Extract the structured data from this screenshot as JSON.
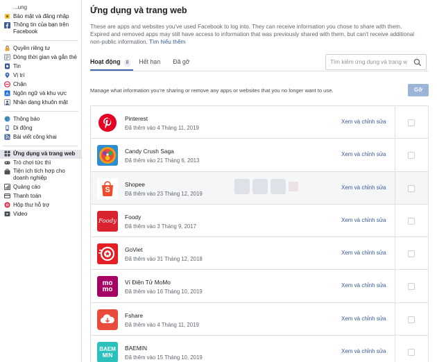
{
  "sidebar": {
    "items": [
      {
        "label": "...ung",
        "icon": "none",
        "partial": true
      },
      {
        "label": "Bảo mật và đăng nhập",
        "icon": "shield-key-icon"
      },
      {
        "label": "Thông tin của bạn trên Facebook",
        "icon": "facebook-icon"
      },
      {
        "label": "Quyền riêng tư",
        "icon": "lock-icon"
      },
      {
        "label": "Dòng thời gian và gắn thẻ",
        "icon": "timeline-icon"
      },
      {
        "label": "Tin",
        "icon": "story-icon"
      },
      {
        "label": "Vị trí",
        "icon": "location-icon"
      },
      {
        "label": "Chặn",
        "icon": "block-icon"
      },
      {
        "label": "Ngôn ngữ và khu vực",
        "icon": "language-icon"
      },
      {
        "label": "Nhận dạng khuôn mặt",
        "icon": "face-recognition-icon"
      },
      {
        "label": "Thông báo",
        "icon": "globe-icon"
      },
      {
        "label": "Di động",
        "icon": "mobile-icon"
      },
      {
        "label": "Bài viết công khai",
        "icon": "rss-icon"
      },
      {
        "label": "Ứng dụng và trang web",
        "icon": "apps-icon"
      },
      {
        "label": "Trò chơi tức thì",
        "icon": "game-icon"
      },
      {
        "label": "Tiện ích tích hợp cho doanh nghiệp",
        "icon": "business-icon"
      },
      {
        "label": "Quảng cáo",
        "icon": "ads-icon"
      },
      {
        "label": "Thanh toán",
        "icon": "payment-icon"
      },
      {
        "label": "Hộp thư hỗ trợ",
        "icon": "support-inbox-icon"
      },
      {
        "label": "Video",
        "icon": "video-icon"
      }
    ]
  },
  "main": {
    "title": "Ứng dụng và trang web",
    "description": "These are apps and websites you've used Facebook to log into. They can receive information you chose to share with them. Expired and removed apps may still have access to information that was previously shared with them, but can't receive additional non-public information.",
    "learn_more": "Tìm hiểu thêm",
    "tabs": [
      {
        "label": "Hoạt động",
        "count": "8"
      },
      {
        "label": "Hết hạn"
      },
      {
        "label": "Đã gỡ"
      }
    ],
    "search_placeholder": "Tìm kiếm ứng dụng và trang w",
    "manage_text": "Manage what information you're sharing or remove any apps or websites that you no longer want to use.",
    "remove_button": "Gỡ",
    "view_edit_label": "Xem và chỉnh sửa",
    "apps": [
      {
        "name": "Pinterest",
        "date": "Đã thêm vào 4 Tháng 11, 2019",
        "color": "#e60023",
        "logo": "pinterest-logo"
      },
      {
        "name": "Candy Crush Saga",
        "date": "Đã thêm vào 21 Tháng 6, 2013",
        "color": "#2a8fd4",
        "logo": "candy-crush-logo"
      },
      {
        "name": "Shopee",
        "date": "Đã thêm vào 23 Tháng 12, 2019",
        "color": "#ee4d2d",
        "logo": "shopee-logo"
      },
      {
        "name": "Foody",
        "date": "Đã thêm vào 3 Tháng 9, 2017",
        "color": "#d9232e",
        "logo": "foody-logo"
      },
      {
        "name": "GoViet",
        "date": "Đã thêm vào 31 Tháng 12, 2018",
        "color": "#e31e24",
        "logo": "goviet-logo"
      },
      {
        "name": "Ví Điện Tử MoMo",
        "date": "Đã thêm vào 16 Tháng 10, 2019",
        "color": "#a50064",
        "logo": "momo-logo"
      },
      {
        "name": "Fshare",
        "date": "Đã thêm vào 4 Tháng 11, 2019",
        "color": "#e84c3d",
        "logo": "fshare-logo"
      },
      {
        "name": "BAEMIN",
        "date": "Đã thêm vào 15 Tháng 10, 2019",
        "color": "#2ac1bc",
        "logo": "baemin-logo"
      }
    ],
    "logo_texts": {
      "shopee": "S",
      "foody": "Foody",
      "momo_top": "mo",
      "momo_bottom": "mo",
      "baemin_top": "BAEM",
      "baemin_bottom": "MIN"
    }
  },
  "colors": {
    "accent": "#4267b2",
    "link": "#385898",
    "remove_button_disabled": "#9cb4d8"
  }
}
